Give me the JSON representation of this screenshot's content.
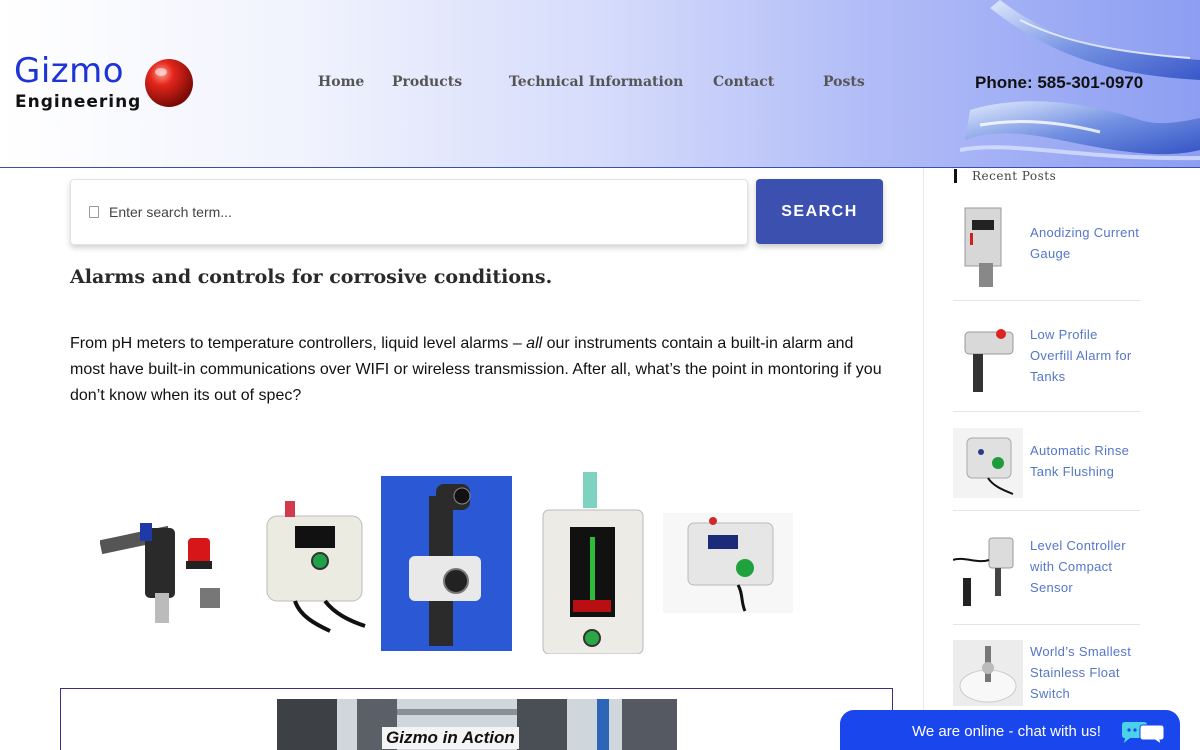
{
  "header": {
    "logo": {
      "line1": "Gizmo",
      "line2": "Engineering"
    },
    "nav": [
      {
        "label": "Home"
      },
      {
        "label": "Products"
      },
      {
        "label": "Technical Information"
      },
      {
        "label": "Contact"
      },
      {
        "label": "Posts"
      }
    ],
    "phone": "Phone: 585-301-0970"
  },
  "search": {
    "placeholder": "Enter search term...",
    "button_label": "SEARCH"
  },
  "main": {
    "heading": "Alarms and controls for corrosive conditions.",
    "paragraph_before": "From pH meters to temperature controllers, liquid level alarms – ",
    "paragraph_em": "all",
    "paragraph_after": " our instruments contain a built-in alarm and most have built-in communications over WIFI or wireless transmission. After all, what’s the point in montoring if you don’t know when its out of spec?",
    "video_caption": "Gizmo in Action"
  },
  "sidebar": {
    "title": "Recent Posts",
    "posts": [
      {
        "title": "Anodizing Current Gauge"
      },
      {
        "title": "Low Profile Overfill Alarm for Tanks"
      },
      {
        "title": "Automatic Rinse Tank Flushing"
      },
      {
        "title": "Level Controller with Compact Sensor"
      },
      {
        "title": "World’s Smallest Stainless Float Switch"
      }
    ]
  },
  "chat": {
    "label": "We are online - chat with us!"
  },
  "colors": {
    "brand_blue": "#1e34d6",
    "button_blue": "#3c50b0",
    "link_blue": "#5576c9",
    "chat_blue": "#1a46ee"
  },
  "icons": [
    "search-icon",
    "chat-icon",
    "logo-ball-icon"
  ]
}
